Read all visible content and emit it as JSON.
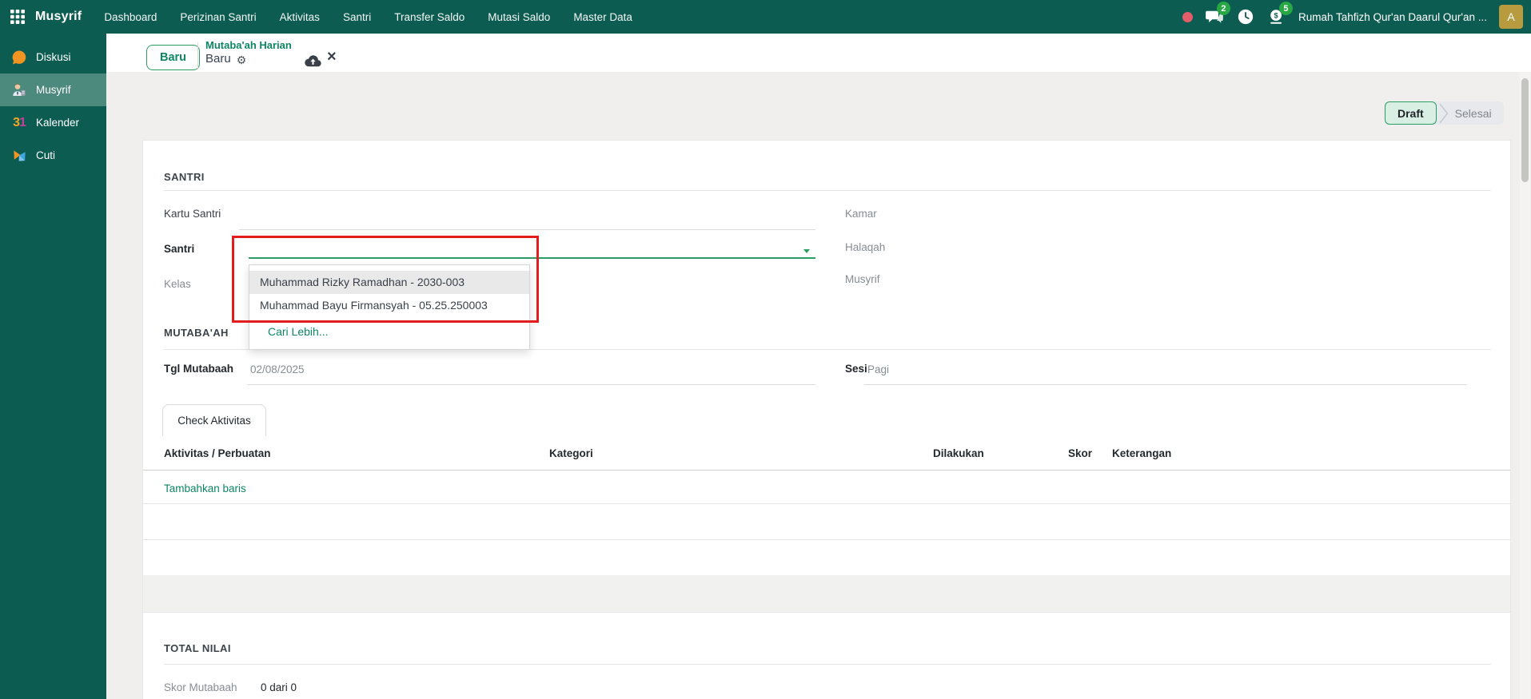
{
  "colors": {
    "topbar_teal": "#0d5c51",
    "sidebar_active": "#4d8a7e",
    "accent_green": "#0e8662",
    "status_active_border": "#2a9d63",
    "status_active_bg": "#d9efe4",
    "badge_green": "#28a745",
    "annotation_red": "#e11d1d",
    "avatar_gold": "#b79b3e"
  },
  "icons": {
    "apps": "grid-3x3",
    "messages": "chat-bubbles",
    "activities": "clock",
    "payroll": "money-coin",
    "record_indicator": "red-dot",
    "settings": "gear",
    "save": "cloud-upload",
    "discard": "x-cross",
    "dropdown_caret": "triangle-down"
  },
  "topbar": {
    "app_name": "Musyrif",
    "menu_items": [
      "Dashboard",
      "Perizinan Santri",
      "Aktivitas",
      "Santri",
      "Transfer Saldo",
      "Mutasi Saldo",
      "Master Data"
    ],
    "messages_badge": "2",
    "activities_badge": "5",
    "company_name": "Rumah Tahfizh Qur'an Daarul Qur'an ...",
    "avatar_initial": "A"
  },
  "sidebar": {
    "items": [
      {
        "label": "Diskusi",
        "icon": "chat-drop",
        "active": false
      },
      {
        "label": "Musyrif",
        "icon": "person",
        "active": true
      },
      {
        "label": "Kalender",
        "icon": "calendar-31",
        "active": false
      },
      {
        "label": "Cuti",
        "icon": "pinwheel",
        "active": false
      }
    ]
  },
  "breadcrumb": {
    "new_button_label": "Baru",
    "model_title": "Mutaba'ah Harian",
    "record_name": "Baru"
  },
  "statusbar": {
    "draft_label": "Draft",
    "done_label": "Selesai"
  },
  "form": {
    "santri_section_title": "SANTRI",
    "labels": {
      "kartu_santri": "Kartu Santri",
      "santri": "Santri",
      "kelas": "Kelas",
      "kamar": "Kamar",
      "halaqah": "Halaqah",
      "musyrif": "Musyrif",
      "tgl_mutabaah": "Tgl Mutabaah",
      "sesi": "Sesi"
    },
    "values": {
      "tgl_mutabaah": "02/08/2025",
      "sesi": "Pagi"
    },
    "santri_dropdown": {
      "options": [
        "Muhammad Rizky Ramadhan - 2030-003",
        "Muhammad Bayu Firmansyah - 05.25.250003"
      ],
      "search_more_label": "Cari Lebih..."
    },
    "mutabaah_section_title": "MUTABA'AH",
    "tab_label": "Check Aktivitas",
    "activity_table": {
      "headers": [
        "Aktivitas / Perbuatan",
        "Kategori",
        "Dilakukan",
        "Skor",
        "Keterangan"
      ],
      "add_row_label": "Tambahkan baris",
      "rows": []
    },
    "total_section_title": "TOTAL NILAI",
    "skor_mutabaah_label": "Skor Mutabaah",
    "skor_mutabaah_value": "0 dari 0"
  }
}
